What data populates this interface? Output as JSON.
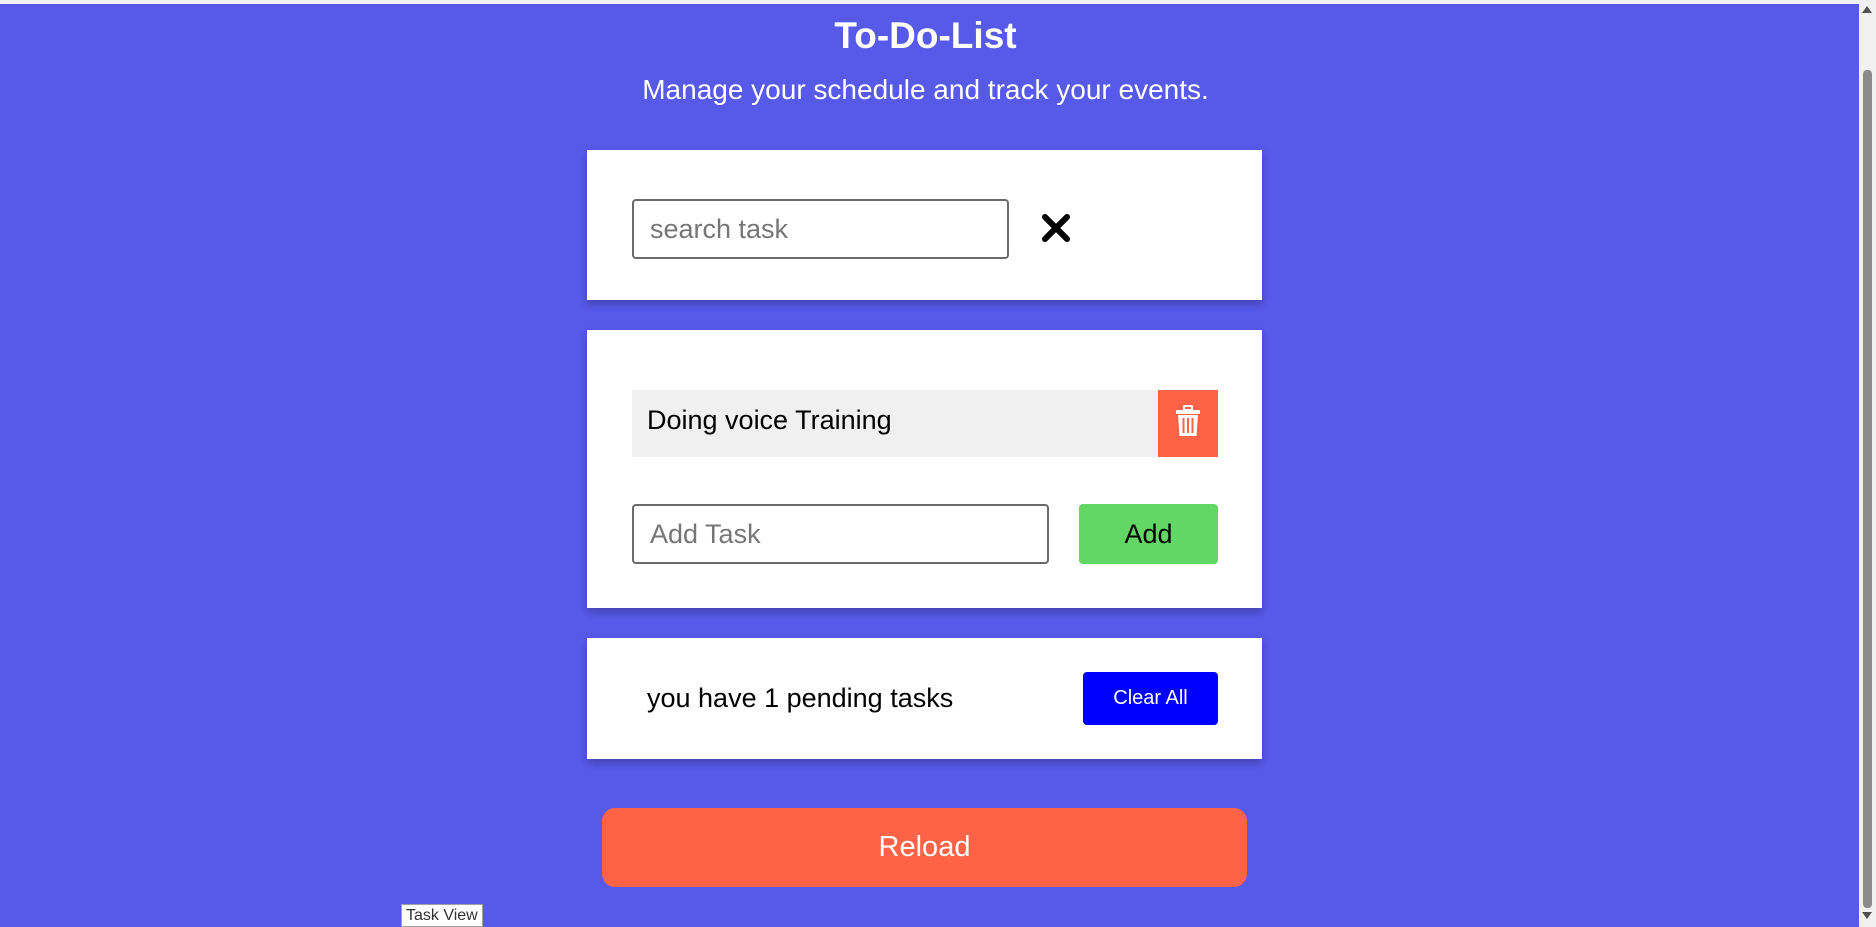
{
  "header": {
    "title": "To-Do-List",
    "subtitle": "Manage your schedule and track your events."
  },
  "search": {
    "placeholder": "search task",
    "value": "",
    "clear_icon": "close-icon"
  },
  "tasks": {
    "items": [
      {
        "text": "Doing voice Training",
        "delete_icon": "trash-icon"
      }
    ],
    "add_placeholder": "Add Task",
    "add_value": "",
    "add_label": "Add"
  },
  "footer": {
    "pending_text": "you have 1 pending tasks",
    "clear_all_label": "Clear All"
  },
  "reload": {
    "label": "Reload"
  },
  "tooltip": {
    "text": "Task View"
  },
  "colors": {
    "background": "#5759e9",
    "card": "#ffffff",
    "delete": "#ff6347",
    "add": "#63d663",
    "clear_all": "#0000ff",
    "reload": "#ff6347",
    "task_row": "#f0f0f0"
  }
}
